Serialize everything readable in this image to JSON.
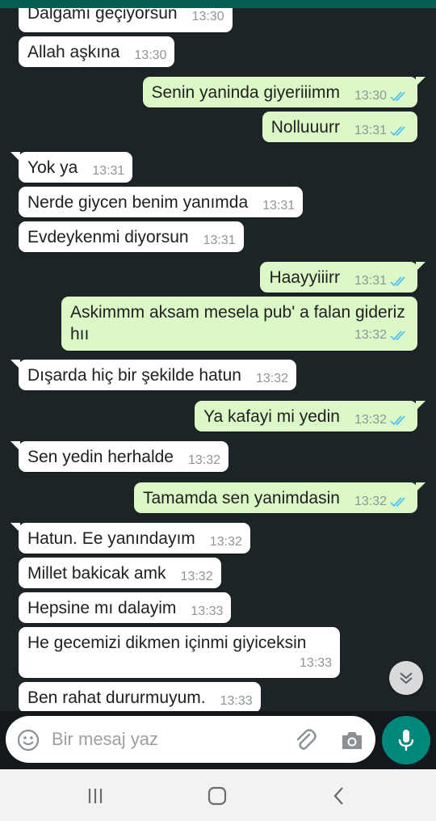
{
  "colors": {
    "chat_background": "#1d2428",
    "incoming_bubble": "#ffffff",
    "outgoing_bubble": "#dcf8c6",
    "read_ticks": "#4fc3f7",
    "accent": "#00897b"
  },
  "messages": [
    {
      "text": "Dalgamı geçiyorsun",
      "time": "13:30",
      "dir": "in"
    },
    {
      "text": "Allah aşkına",
      "time": "13:30",
      "dir": "in"
    },
    {
      "text": "Senin yaninda giyeriiimm",
      "time": "13:30",
      "dir": "out",
      "status": "read"
    },
    {
      "text": "Nolluuurr",
      "time": "13:31",
      "dir": "out",
      "status": "read"
    },
    {
      "text": "Yok ya",
      "time": "13:31",
      "dir": "in"
    },
    {
      "text": "Nerde giycen benim yanımda",
      "time": "13:31",
      "dir": "in"
    },
    {
      "text": "Evdeykenmi diyorsun",
      "time": "13:31",
      "dir": "in"
    },
    {
      "text": "Haayyiiirr",
      "time": "13:31",
      "dir": "out",
      "status": "read"
    },
    {
      "text": "Askimmm aksam mesela pub' a falan gideriz hıı",
      "time": "13:32",
      "dir": "out",
      "status": "read"
    },
    {
      "text": "Dışarda hiç bir şekilde hatun",
      "time": "13:32",
      "dir": "in"
    },
    {
      "text": "Ya kafayi mi yedin",
      "time": "13:32",
      "dir": "out",
      "status": "read"
    },
    {
      "text": "Sen yedin herhalde",
      "time": "13:32",
      "dir": "in"
    },
    {
      "text": "Tamamda sen yanimdasin",
      "time": "13:32",
      "dir": "out",
      "status": "read"
    },
    {
      "text": "Hatun. Ee yanındayım",
      "time": "13:32",
      "dir": "in"
    },
    {
      "text": "Millet bakicak amk",
      "time": "13:32",
      "dir": "in"
    },
    {
      "text": "Hepsine mı dalayim",
      "time": "13:33",
      "dir": "in"
    },
    {
      "text": "He gecemizi dikmen içinmi giyiceksin",
      "time": "13:33",
      "dir": "in"
    },
    {
      "text": "Ben rahat dururmuyum.",
      "time": "13:33",
      "dir": "in"
    }
  ],
  "composer": {
    "placeholder": "Bir mesaj yaz",
    "emoji_icon": "emoji-icon",
    "attach_icon": "paperclip-icon",
    "camera_icon": "camera-icon",
    "mic_icon": "microphone-icon"
  },
  "scroll_down_icon": "double-chevron-down-icon",
  "navbar_icons": [
    "recent-apps-icon",
    "home-icon",
    "back-icon"
  ]
}
